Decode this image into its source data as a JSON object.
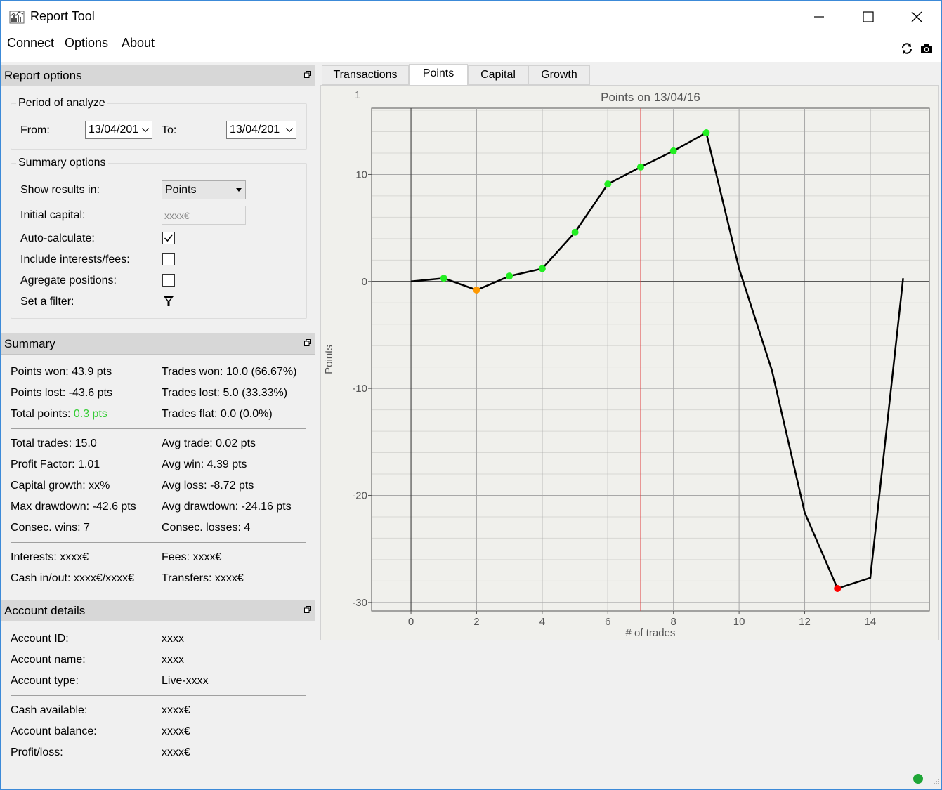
{
  "window": {
    "title": "Report Tool"
  },
  "menu": {
    "items": [
      "Connect",
      "Options",
      "About"
    ]
  },
  "report_options": {
    "header": "Report options",
    "period": {
      "title": "Period of analyze",
      "from_label": "From:",
      "from_value": "13/04/201",
      "to_label": "To:",
      "to_value": "13/04/201"
    },
    "summary_options": {
      "title": "Summary options",
      "show_results_label": "Show results in:",
      "show_results_value": "Points",
      "initial_capital_label": "Initial capital:",
      "initial_capital_placeholder": "xxxx€",
      "auto_calculate_label": "Auto-calculate:",
      "auto_calculate_checked": true,
      "include_fees_label": "Include interests/fees:",
      "include_fees_checked": false,
      "aggregate_label": "Agregate positions:",
      "aggregate_checked": false,
      "filter_label": "Set a filter:"
    }
  },
  "summary": {
    "header": "Summary",
    "points_won": "Points won: 43.9 pts",
    "trades_won": "Trades won: 10.0 (66.67%)",
    "points_lost": "Points lost: -43.6 pts",
    "trades_lost": "Trades lost: 5.0 (33.33%)",
    "total_points_label": "Total points:",
    "total_points_value": "0.3 pts",
    "total_points_color": "#33cc33",
    "trades_flat": "Trades flat: 0.0 (0.0%)",
    "total_trades": "Total trades: 15.0",
    "avg_trade": "Avg trade: 0.02 pts",
    "profit_factor": "Profit Factor: 1.01",
    "avg_win": "Avg win: 4.39 pts",
    "capital_growth": "Capital growth: xx%",
    "avg_loss": "Avg loss: -8.72 pts",
    "max_drawdown": "Max drawdown: -42.6 pts",
    "avg_drawdown": "Avg drawdown: -24.16 pts",
    "consec_wins": "Consec. wins: 7",
    "consec_losses": "Consec. losses: 4",
    "interests": "Interests: xxxx€",
    "fees": "Fees: xxxx€",
    "cash_in_out": "Cash in/out: xxxx€/xxxx€",
    "transfers": "Transfers: xxxx€"
  },
  "account": {
    "header": "Account details",
    "rows": [
      {
        "label": "Account ID:",
        "value": "xxxx"
      },
      {
        "label": "Account name:",
        "value": "xxxx"
      },
      {
        "label": "Account type:",
        "value": "Live-xxxx"
      },
      {
        "label": "Cash available:",
        "value": "xxxx€"
      },
      {
        "label": "Account balance:",
        "value": "xxxx€"
      },
      {
        "label": "Profit/loss:",
        "value": "xxxx€"
      }
    ]
  },
  "tabs": [
    "Transactions",
    "Points",
    "Capital",
    "Growth"
  ],
  "active_tab": "Points",
  "icons": {
    "app": "chart-app-icon",
    "refresh": "refresh-icon",
    "screenshot": "camera-icon",
    "filter": "filter-icon",
    "status": "status-ok-icon"
  },
  "colors": {
    "win_point": "#22ee22",
    "loss_point": "#ff9900",
    "min_point": "#ff0000",
    "status_ok": "#1fa637"
  },
  "chart_data": [
    {
      "type": "line",
      "title": "Points on 13/04/16",
      "xlabel": "# of trades",
      "ylabel": "Points",
      "corner_label": "1",
      "x": [
        0,
        1,
        2,
        3,
        4,
        5,
        6,
        7,
        8,
        9,
        10,
        11,
        12,
        13,
        14,
        15
      ],
      "y": [
        0,
        0.3,
        -0.8,
        0.5,
        1.2,
        4.6,
        9.1,
        10.7,
        12.2,
        13.9,
        1.2,
        -8.3,
        -21.6,
        -28.7,
        -27.7,
        0.3
      ],
      "marker_colors": [
        "none",
        "win",
        "loss",
        "win",
        "win",
        "win",
        "win",
        "win",
        "win",
        "win",
        "none",
        "none",
        "none",
        "min",
        "none",
        "none"
      ],
      "xlim": [
        -1.2,
        15.8
      ],
      "ylim": [
        -30.8,
        16.2
      ],
      "xticks": [
        0,
        2,
        4,
        6,
        8,
        10,
        12,
        14
      ],
      "yticks": [
        10,
        0,
        -10,
        -20,
        -30
      ],
      "vline_x": 7,
      "grid": true
    },
    {
      "type": "line",
      "title": "",
      "corner_label": "1",
      "x": [
        0,
        1,
        2,
        3,
        4,
        5,
        6,
        7,
        8,
        9,
        10,
        11,
        12,
        13,
        14,
        15
      ],
      "y": [
        0,
        0.3,
        -0.8,
        0.5,
        1.2,
        4.6,
        9.1,
        10.7,
        12.2,
        13.9,
        1.2,
        -8.3,
        -21.6,
        -28.7,
        -27.7,
        0.3
      ],
      "xlim": [
        -0.55,
        15.55
      ],
      "xticks": [
        0,
        2,
        4,
        6,
        8,
        10,
        12,
        14
      ],
      "grid": true
    }
  ]
}
